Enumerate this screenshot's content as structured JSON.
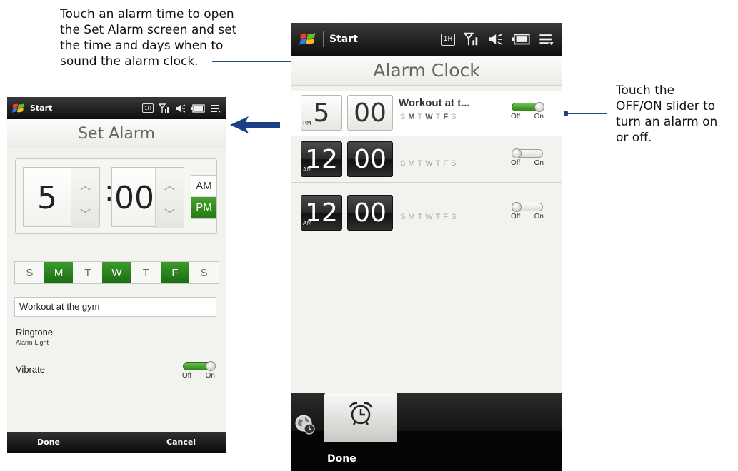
{
  "callouts": {
    "left": [
      "Touch an alarm time to open",
      "the Set Alarm screen and set",
      "the time and days when to",
      "sound the alarm clock."
    ],
    "right": [
      "Touch the",
      "OFF/ON slider to",
      "turn an alarm on",
      "or off."
    ]
  },
  "set_alarm_screen": {
    "status": {
      "start_label": "Start",
      "network_badge": "1H"
    },
    "title": "Set Alarm",
    "hour": "5",
    "colon": ":",
    "minute": "00",
    "am": "AM",
    "pm": "PM",
    "selected_period": "PM",
    "days": [
      {
        "label": "S",
        "selected": false
      },
      {
        "label": "M",
        "selected": true
      },
      {
        "label": "T",
        "selected": false
      },
      {
        "label": "W",
        "selected": true
      },
      {
        "label": "T",
        "selected": false
      },
      {
        "label": "F",
        "selected": true
      },
      {
        "label": "S",
        "selected": false
      }
    ],
    "description": "Workout at the gym",
    "ringtone_label": "Ringtone",
    "ringtone_value": "Alarm-Light",
    "vibrate_label": "Vibrate",
    "vibrate_on": true,
    "toggle_off": "Off",
    "toggle_on": "On",
    "done": "Done",
    "cancel": "Cancel"
  },
  "alarm_clock_screen": {
    "status": {
      "start_label": "Start",
      "network_badge": "1H"
    },
    "title": "Alarm Clock",
    "weekday_letters": [
      "S",
      "M",
      "T",
      "W",
      "T",
      "F",
      "S"
    ],
    "alarms": [
      {
        "hour": "5",
        "minute": "00",
        "period": "PM",
        "name": "Workout at t...",
        "enabled": true,
        "active_days": [
          1,
          3,
          5
        ]
      },
      {
        "hour": "12",
        "minute": "00",
        "period": "AM",
        "name": "",
        "enabled": false,
        "active_days": []
      },
      {
        "hour": "12",
        "minute": "00",
        "period": "AM",
        "name": "",
        "enabled": false,
        "active_days": []
      }
    ],
    "toggle_off": "Off",
    "toggle_on": "On",
    "done": "Done"
  },
  "icons": [
    "windows-flag-icon",
    "network-1h-icon",
    "signal-icon",
    "speaker-icon",
    "battery-icon",
    "menu-icon",
    "alarm-clock-icon",
    "world-clock-icon",
    "arrow-left-icon",
    "chevron-up-icon",
    "chevron-down-icon"
  ],
  "colors": {
    "accent_green": "#2f8c1e",
    "callout_blue": "#1d3f86",
    "statusbar": "#111111"
  }
}
